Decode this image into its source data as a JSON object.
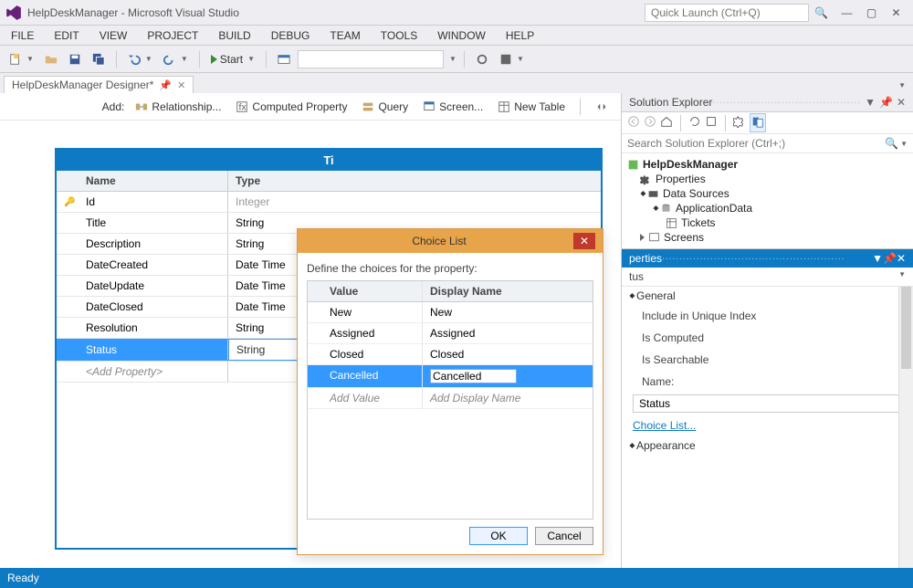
{
  "window": {
    "title": "HelpDeskManager - Microsoft Visual Studio",
    "quicklaunch_placeholder": "Quick Launch (Ctrl+Q)"
  },
  "menus": [
    "FILE",
    "EDIT",
    "VIEW",
    "PROJECT",
    "BUILD",
    "DEBUG",
    "TEAM",
    "TOOLS",
    "WINDOW",
    "HELP"
  ],
  "toolbar": {
    "start": "Start"
  },
  "doc_tab": {
    "label": "HelpDeskManager Designer*"
  },
  "designer_toolbar": {
    "add_label": "Add:",
    "items": [
      "Relationship...",
      "Computed Property",
      "Query",
      "Screen...",
      "New Table"
    ]
  },
  "entity": {
    "title": "Ti",
    "headers": {
      "name": "Name",
      "type": "Type"
    },
    "rows": [
      {
        "key": true,
        "name": "Id",
        "type": "Integer",
        "selected": false
      },
      {
        "key": false,
        "name": "Title",
        "type": "String",
        "selected": false
      },
      {
        "key": false,
        "name": "Description",
        "type": "String",
        "selected": false
      },
      {
        "key": false,
        "name": "DateCreated",
        "type": "Date Time",
        "selected": false
      },
      {
        "key": false,
        "name": "DateUpdate",
        "type": "Date Time",
        "selected": false
      },
      {
        "key": false,
        "name": "DateClosed",
        "type": "Date Time",
        "selected": false
      },
      {
        "key": false,
        "name": "Resolution",
        "type": "String",
        "selected": false
      },
      {
        "key": false,
        "name": "Status",
        "type": "String",
        "selected": true
      }
    ],
    "add_placeholder": "<Add Property>"
  },
  "dialog": {
    "title": "Choice List",
    "subtitle": "Define the choices for the property:",
    "headers": {
      "value": "Value",
      "display": "Display Name"
    },
    "rows": [
      {
        "value": "New",
        "display": "New",
        "selected": false
      },
      {
        "value": "Assigned",
        "display": "Assigned",
        "selected": false
      },
      {
        "value": "Closed",
        "display": "Closed",
        "selected": false
      },
      {
        "value": "Cancelled",
        "display": "Cancelled",
        "selected": true,
        "editing": true
      }
    ],
    "add_value": "Add Value",
    "add_display": "Add Display Name",
    "ok": "OK",
    "cancel": "Cancel"
  },
  "solution_explorer": {
    "title": "Solution Explorer",
    "search_placeholder": "Search Solution Explorer (Ctrl+;)",
    "nodes": {
      "root": "HelpDeskManager",
      "props": "Properties",
      "ds": "Data Sources",
      "appdata": "ApplicationData",
      "tickets": "Tickets",
      "screens": "Screens"
    }
  },
  "properties": {
    "title": "perties",
    "object": "tus",
    "cat_general": "General",
    "rows": [
      "Include in Unique Index",
      "Is Computed",
      "Is Searchable"
    ],
    "name_label": "Name:",
    "name_value": "Status",
    "choice_link": "Choice List...",
    "cat_appearance": "Appearance"
  },
  "status": "Ready"
}
